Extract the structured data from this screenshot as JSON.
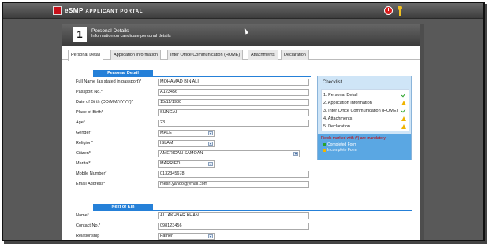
{
  "app": {
    "title": "eSMP",
    "subtitle": "APPLICANT PORTAL"
  },
  "step": {
    "number": "1",
    "title": "Personal Details",
    "subtitle": "Information on candidate personal details"
  },
  "tabs": [
    {
      "label": "Personal Detail",
      "active": true
    },
    {
      "label": "Application Information",
      "active": false
    },
    {
      "label": "Inter Office Communication (HOME)",
      "active": false
    },
    {
      "label": "Attachments",
      "active": false
    },
    {
      "label": "Declaration",
      "active": false
    }
  ],
  "personal_section": {
    "title": "Personal Detail",
    "fields": [
      {
        "label": "Full Name (as stated in passport)*",
        "value": "MOHAMAD BIN ALI"
      },
      {
        "label": "Passport No.*",
        "value": "A123456"
      },
      {
        "label": "Date of Birth (DD/MM/YYYY)*",
        "value": "15/11/1980"
      },
      {
        "label": "Place of Birth*",
        "value": "SUNGAI"
      },
      {
        "label": "Age*",
        "value": "23"
      },
      {
        "label": "Gender*",
        "value": "MALE"
      },
      {
        "label": "Religion*",
        "value": "ISLAM"
      },
      {
        "label": "Citizen*",
        "value": "AMERICAN SAMOAN"
      },
      {
        "label": "Marital*",
        "value": "MARRIED"
      },
      {
        "label": "Mobile Number*",
        "value": "0132345678"
      },
      {
        "label": "Email Address*",
        "value": "mesri.yahoo@ymail.com"
      }
    ]
  },
  "next_of_kin_section": {
    "title": "Next of Kin",
    "fields": [
      {
        "label": "Name*",
        "value": "ALI AKHBAR KHAN"
      },
      {
        "label": "Contact No.*",
        "value": "098123456"
      },
      {
        "label": "Relationship",
        "value": "Father"
      }
    ]
  },
  "checklist": {
    "title": "Checklist",
    "items": [
      {
        "label": "1. Personal Detail",
        "status": "complete"
      },
      {
        "label": "2. Application Information",
        "status": "incomplete"
      },
      {
        "label": "3. Inter Office Communication (HOME)",
        "status": "complete"
      },
      {
        "label": "4. Attachments",
        "status": "incomplete"
      },
      {
        "label": "5. Declaration",
        "status": "incomplete"
      }
    ],
    "note": "Fields marked with (*) are mandatory.",
    "legend": [
      {
        "label": "Completed Form",
        "color": "#2aa32a"
      },
      {
        "label": "Incomplete Form",
        "color": "#f0b400"
      }
    ]
  },
  "colors": {
    "accent": "#2580d8",
    "brand": "#c8101a"
  }
}
